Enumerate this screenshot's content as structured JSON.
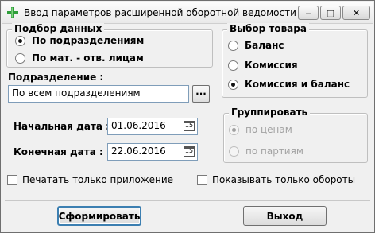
{
  "window": {
    "title": "Ввод параметров расширенной оборотной ведомости",
    "controls": {
      "minimize": "‒",
      "maximize": "□",
      "close": "✕"
    }
  },
  "data_selection": {
    "title": "Подбор данных",
    "options": [
      {
        "label": "По подразделениям",
        "checked": true
      },
      {
        "label": "По мат. - отв. лицам",
        "checked": false
      }
    ]
  },
  "goods_selection": {
    "title": "Выбор товара",
    "options": [
      {
        "label": "Баланс",
        "checked": false
      },
      {
        "label": "Комиссия",
        "checked": false
      },
      {
        "label": "Комиссия и баланс",
        "checked": true
      }
    ]
  },
  "department": {
    "label": "Подразделение :",
    "value": "По всем подразделениям",
    "browse_label": "..."
  },
  "start_date": {
    "label": "Начальная дата :",
    "value": "01.06.2016",
    "calendar_icon": "15"
  },
  "end_date": {
    "label": "Конечная дата :",
    "value": "22.06.2016",
    "calendar_icon": "15"
  },
  "grouping": {
    "title": "Группировать",
    "enabled": false,
    "options": [
      {
        "label": "по ценам",
        "checked": true
      },
      {
        "label": "по партиям",
        "checked": false
      }
    ]
  },
  "checkboxes": {
    "print_appendix_only": {
      "label": "Печатать только приложение",
      "checked": false
    },
    "show_turnover_only": {
      "label": "Показывать только обороты",
      "checked": false
    }
  },
  "buttons": {
    "generate": "Сформировать",
    "exit": "Выход"
  },
  "colors": {
    "window_bg": "#f0f0f0",
    "field_border": "#7f9db9",
    "default_button_border": "#3c7fb1"
  }
}
